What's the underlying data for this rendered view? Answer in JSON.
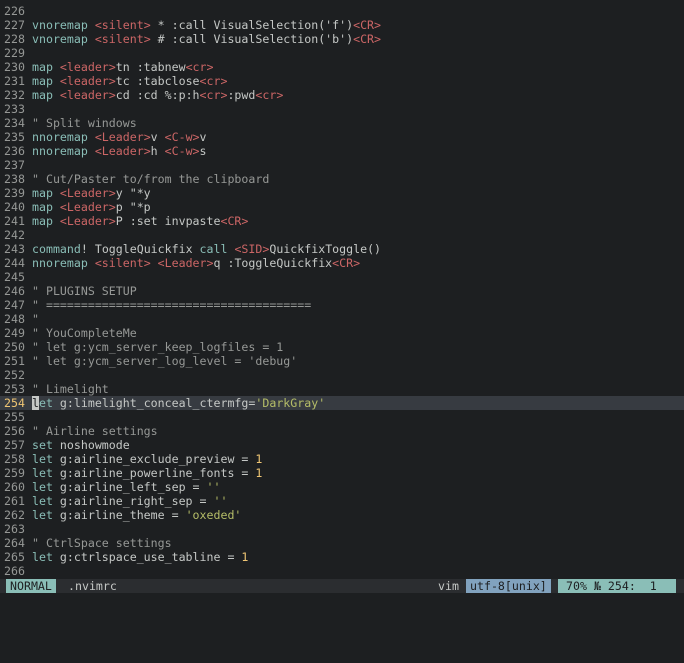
{
  "editor": {
    "lines": [
      {
        "n": "226",
        "t": []
      },
      {
        "n": "227",
        "t": [
          [
            "k",
            "vnoremap "
          ],
          [
            "a",
            "<silent>"
          ],
          [
            "n",
            " * :call VisualSelection('f')"
          ],
          [
            "a",
            "<CR>"
          ]
        ]
      },
      {
        "n": "228",
        "t": [
          [
            "k",
            "vnoremap "
          ],
          [
            "a",
            "<silent>"
          ],
          [
            "n",
            " # :call VisualSelection('b')"
          ],
          [
            "a",
            "<CR>"
          ]
        ]
      },
      {
        "n": "229",
        "t": []
      },
      {
        "n": "230",
        "t": [
          [
            "k",
            "map "
          ],
          [
            "a",
            "<leader>"
          ],
          [
            "n",
            "tn :tabnew"
          ],
          [
            "a",
            "<cr>"
          ]
        ]
      },
      {
        "n": "231",
        "t": [
          [
            "k",
            "map "
          ],
          [
            "a",
            "<leader>"
          ],
          [
            "n",
            "tc :tabclose"
          ],
          [
            "a",
            "<cr>"
          ]
        ]
      },
      {
        "n": "232",
        "t": [
          [
            "k",
            "map "
          ],
          [
            "a",
            "<leader>"
          ],
          [
            "n",
            "cd :cd %:p:h"
          ],
          [
            "a",
            "<cr>"
          ],
          [
            "n",
            ":pwd"
          ],
          [
            "a",
            "<cr>"
          ]
        ]
      },
      {
        "n": "233",
        "t": []
      },
      {
        "n": "234",
        "t": [
          [
            "c",
            "\" Split windows"
          ]
        ]
      },
      {
        "n": "235",
        "t": [
          [
            "k",
            "nnoremap "
          ],
          [
            "a",
            "<Leader>"
          ],
          [
            "n",
            "v "
          ],
          [
            "a",
            "<C-w>"
          ],
          [
            "n",
            "v"
          ]
        ]
      },
      {
        "n": "236",
        "t": [
          [
            "k",
            "nnoremap "
          ],
          [
            "a",
            "<Leader>"
          ],
          [
            "n",
            "h "
          ],
          [
            "a",
            "<C-w>"
          ],
          [
            "n",
            "s"
          ]
        ]
      },
      {
        "n": "237",
        "t": []
      },
      {
        "n": "238",
        "t": [
          [
            "c",
            "\" Cut/Paster to/from the clipboard"
          ]
        ]
      },
      {
        "n": "239",
        "t": [
          [
            "k",
            "map "
          ],
          [
            "a",
            "<Leader>"
          ],
          [
            "n",
            "y \"*y"
          ]
        ]
      },
      {
        "n": "240",
        "t": [
          [
            "k",
            "map "
          ],
          [
            "a",
            "<Leader>"
          ],
          [
            "n",
            "p \"*p"
          ]
        ]
      },
      {
        "n": "241",
        "t": [
          [
            "k",
            "map "
          ],
          [
            "a",
            "<Leader>"
          ],
          [
            "n",
            "P :set invpaste"
          ],
          [
            "a",
            "<CR>"
          ]
        ]
      },
      {
        "n": "242",
        "t": []
      },
      {
        "n": "243",
        "t": [
          [
            "k",
            "command"
          ],
          [
            "n",
            "! ToggleQuickfix "
          ],
          [
            "k",
            "call "
          ],
          [
            "a",
            "<SID>"
          ],
          [
            "n",
            "QuickfixToggle()"
          ]
        ]
      },
      {
        "n": "244",
        "t": [
          [
            "k",
            "nnoremap "
          ],
          [
            "a",
            "<silent>"
          ],
          [
            "n",
            " "
          ],
          [
            "a",
            "<Leader>"
          ],
          [
            "n",
            "q :ToggleQuickfix"
          ],
          [
            "a",
            "<CR>"
          ]
        ]
      },
      {
        "n": "245",
        "t": []
      },
      {
        "n": "246",
        "t": [
          [
            "c",
            "\" PLUGINS SETUP"
          ]
        ]
      },
      {
        "n": "247",
        "t": [
          [
            "c",
            "\" ======================================"
          ]
        ]
      },
      {
        "n": "248",
        "t": [
          [
            "c",
            "\""
          ]
        ]
      },
      {
        "n": "249",
        "t": [
          [
            "c",
            "\" YouCompleteMe"
          ]
        ]
      },
      {
        "n": "250",
        "t": [
          [
            "c",
            "\" let g:ycm_server_keep_logfiles = 1"
          ]
        ]
      },
      {
        "n": "251",
        "t": [
          [
            "c",
            "\" let g:ycm_server_log_level = 'debug'"
          ]
        ]
      },
      {
        "n": "252",
        "t": []
      },
      {
        "n": "253",
        "t": [
          [
            "c",
            "\" Limelight"
          ]
        ]
      },
      {
        "n": "254",
        "cur": true,
        "t": [
          [
            "cursor",
            "l"
          ],
          [
            "k",
            "et"
          ],
          [
            "n",
            " g:limelight_conceal_ctermfg="
          ],
          [
            "s",
            "'DarkGray'"
          ]
        ]
      },
      {
        "n": "255",
        "t": []
      },
      {
        "n": "256",
        "t": [
          [
            "c",
            "\" Airline settings"
          ]
        ]
      },
      {
        "n": "257",
        "t": [
          [
            "k",
            "set "
          ],
          [
            "n",
            "noshowmode"
          ]
        ]
      },
      {
        "n": "258",
        "t": [
          [
            "k",
            "let "
          ],
          [
            "n",
            "g:airline_exclude_preview = "
          ],
          [
            "u",
            "1"
          ]
        ]
      },
      {
        "n": "259",
        "t": [
          [
            "k",
            "let "
          ],
          [
            "n",
            "g:airline_powerline_fonts = "
          ],
          [
            "u",
            "1"
          ]
        ]
      },
      {
        "n": "260",
        "t": [
          [
            "k",
            "let "
          ],
          [
            "n",
            "g:airline_left_sep = "
          ],
          [
            "s",
            "''"
          ]
        ]
      },
      {
        "n": "261",
        "t": [
          [
            "k",
            "let "
          ],
          [
            "n",
            "g:airline_right_sep = "
          ],
          [
            "s",
            "''"
          ]
        ]
      },
      {
        "n": "262",
        "t": [
          [
            "k",
            "let "
          ],
          [
            "n",
            "g:airline_theme = "
          ],
          [
            "s",
            "'oxeded'"
          ]
        ]
      },
      {
        "n": "263",
        "t": []
      },
      {
        "n": "264",
        "t": [
          [
            "c",
            "\" CtrlSpace settings"
          ]
        ]
      },
      {
        "n": "265",
        "t": [
          [
            "k",
            "let "
          ],
          [
            "n",
            "g:ctrlspace_use_tabline = "
          ],
          [
            "u",
            "1"
          ]
        ]
      },
      {
        "n": "266",
        "t": []
      }
    ]
  },
  "status": {
    "mode": "NORMAL",
    "filename": ".nvimrc",
    "filetype": "vim",
    "encoding": "utf-8[unix]",
    "position": "70% № 254:  1"
  },
  "colors": {
    "background": "#1d1f21",
    "keyword": "#8abeb7",
    "comment": "#969896",
    "angle_tag": "#cc6666",
    "string": "#b5bd68",
    "number": "#f0c674"
  }
}
